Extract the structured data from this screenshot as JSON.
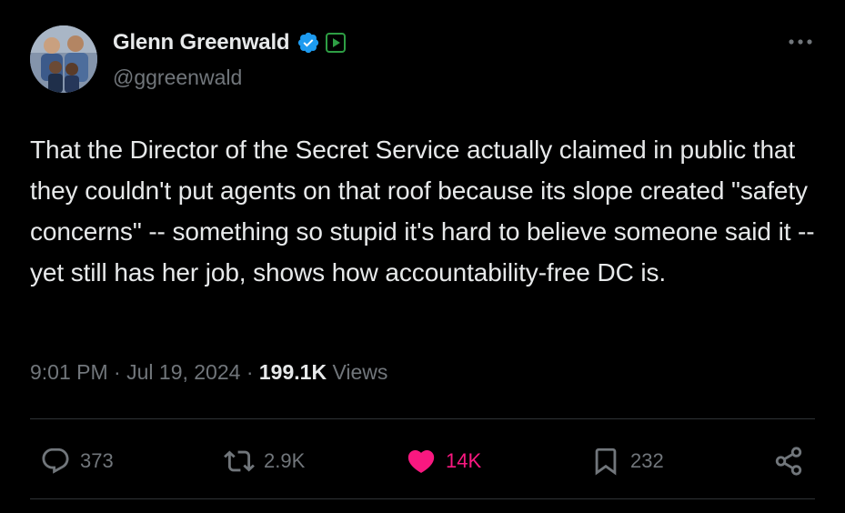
{
  "author": {
    "name": "Glenn Greenwald",
    "handle": "@ggreenwald",
    "verified_color": "#1d9bf0",
    "affiliate_badge_color": "#2e7d32"
  },
  "tweet": {
    "text": "That the Director of the Secret Service actually claimed in public that they couldn't put agents on that roof because its slope created \"safety concerns\" -- something so stupid it's hard to believe someone said it -- yet still has her job, shows how accountability-free DC is.",
    "time": "9:01 PM",
    "separator": "·",
    "date": "Jul 19, 2024",
    "views_count": "199.1K",
    "views_label": "Views"
  },
  "actions": {
    "reply": {
      "icon": "reply-icon",
      "count": "373"
    },
    "retweet": {
      "icon": "retweet-icon",
      "count": "2.9K"
    },
    "like": {
      "icon": "heart-icon",
      "count": "14K",
      "color": "#f91880",
      "liked": true
    },
    "bookmark": {
      "icon": "bookmark-icon",
      "count": "232"
    },
    "share": {
      "icon": "share-icon"
    }
  },
  "colors": {
    "background": "#000000",
    "text": "#e7e9ea",
    "muted": "#71767b",
    "divider": "#2f3336"
  }
}
